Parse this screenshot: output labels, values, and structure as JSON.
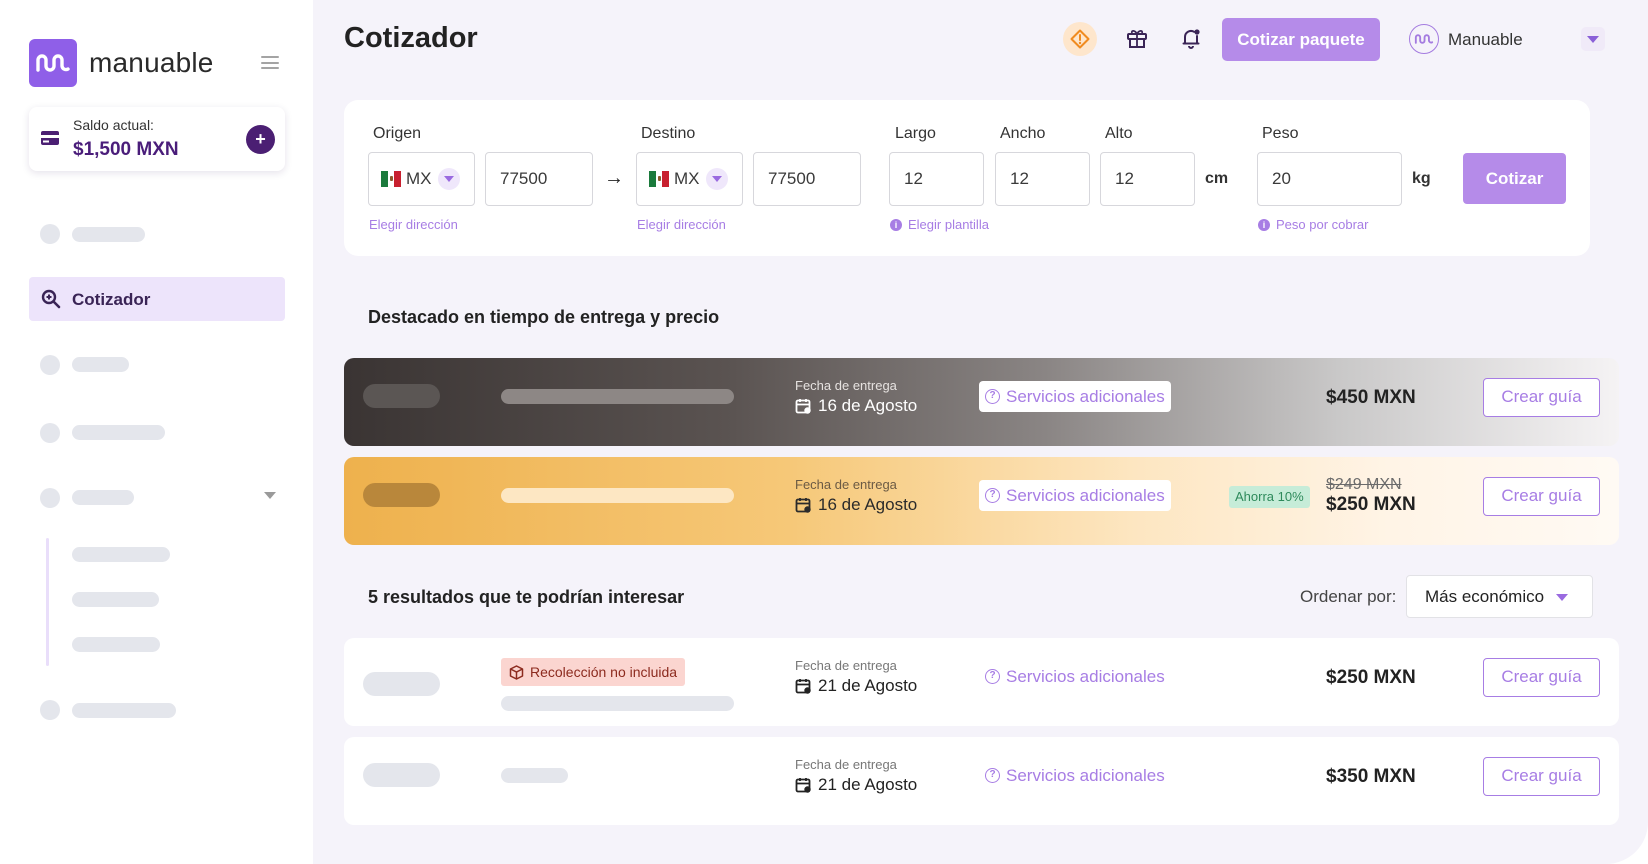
{
  "brand": {
    "name": "manuable",
    "color": "#8f5fe8"
  },
  "balance": {
    "label": "Saldo actual:",
    "value": "$1,500 MXN"
  },
  "sidebar": {
    "active_item": "Cotizador"
  },
  "header": {
    "title": "Cotizador",
    "quote_package_button": "Cotizar paquete",
    "user_name": "Manuable"
  },
  "form": {
    "origin": {
      "label": "Origen",
      "country": "MX",
      "zip": "77500",
      "link": "Elegir dirección"
    },
    "destination": {
      "label": "Destino",
      "country": "MX",
      "zip": "77500",
      "link": "Elegir dirección"
    },
    "length": {
      "label": "Largo",
      "value": "12"
    },
    "width": {
      "label": "Ancho",
      "value": "12"
    },
    "height": {
      "label": "Alto",
      "value": "12"
    },
    "dimension_unit": "cm",
    "template_link": "Elegir plantilla",
    "weight": {
      "label": "Peso",
      "value": "20",
      "unit": "kg",
      "link": "Peso por cobrar"
    },
    "submit": "Cotizar"
  },
  "featured": {
    "title": "Destacado en tiempo  de entrega y precio",
    "rows": [
      {
        "date_label": "Fecha de entrega",
        "date": "16 de Agosto",
        "services": "Servicios adicionales",
        "price": "$450 MXN",
        "action": "Crear guía"
      },
      {
        "date_label": "Fecha de entrega",
        "date": "16 de Agosto",
        "services": "Servicios adicionales",
        "badge": "Ahorra 10%",
        "old_price": "$249 MXN",
        "price": "$250 MXN",
        "action": "Crear guía"
      }
    ]
  },
  "results": {
    "title": "5 resultados que te podrían interesar",
    "sort_label": "Ordenar por:",
    "sort_value": "Más económico",
    "rows": [
      {
        "warning": "Recolección no incluida",
        "date_label": "Fecha de entrega",
        "date": "21 de Agosto",
        "services": "Servicios adicionales",
        "price": "$250 MXN",
        "action": "Crear guía"
      },
      {
        "date_label": "Fecha de entrega",
        "date": "21 de Agosto",
        "services": "Servicios adicionales",
        "price": "$350 MXN",
        "action": "Crear guía"
      }
    ]
  },
  "colors": {
    "accent": "#b58be9",
    "link": "#a77de4",
    "dark_purple": "#4b1f73",
    "warn_bg": "#fee6cc"
  }
}
